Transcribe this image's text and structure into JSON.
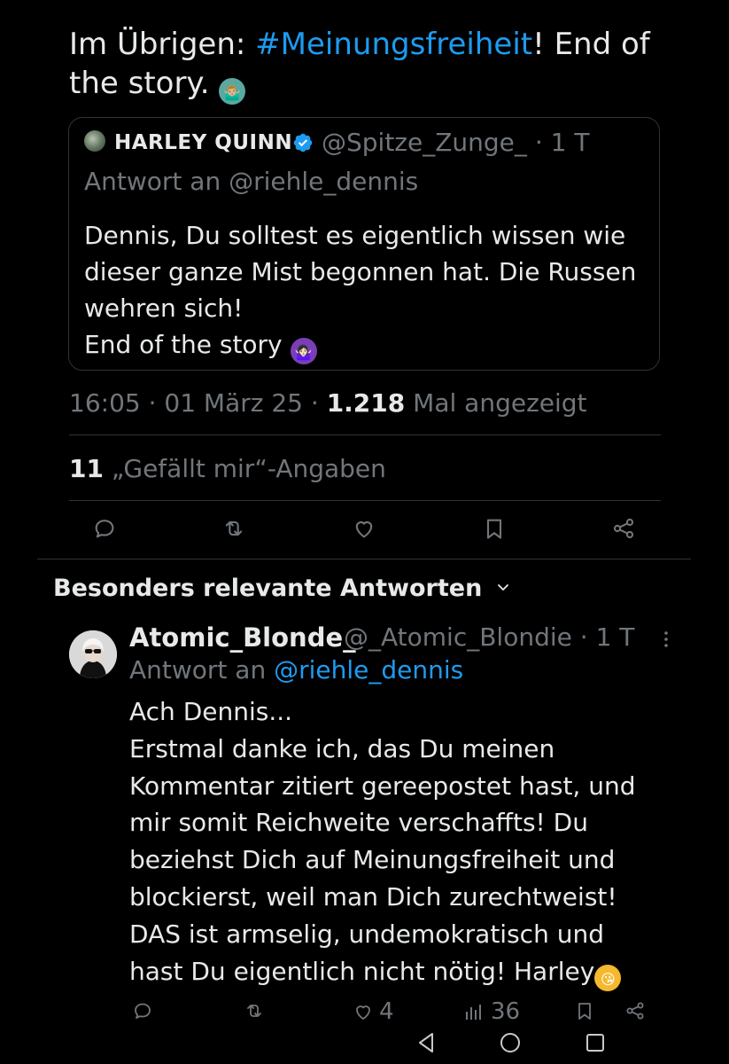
{
  "tweet": {
    "text_before": "Im Übrigen: ",
    "hashtag": "#Meinungsfreiheit",
    "text_after": "! End of the story. ",
    "emoji": "🤷🏼‍♂️"
  },
  "quote": {
    "name": "HARLEY QUINN",
    "handle": "@Spitze_Zunge_",
    "time": "· 1 T",
    "reply_to": "Antwort an @riehle_dennis",
    "body_lines": [
      "Dennis, Du solltest es eigentlich wissen wie",
      "dieser ganze Mist begonnen hat. Die Russen",
      "wehren sich!",
      "End of the story "
    ],
    "emoji": "🤷🏻‍♀️"
  },
  "meta": {
    "time": "16:05 · 01 März 25 · ",
    "views_count": "1.218",
    "views_label": " Mal angezeigt"
  },
  "likes": {
    "count": "11",
    "label": " „Gefällt mir“-Angaben"
  },
  "actions": {
    "icons": [
      "reply-icon",
      "retweet-icon",
      "like-icon",
      "bookmark-icon",
      "share-icon"
    ]
  },
  "section": {
    "title": "Besonders relevante Antworten"
  },
  "reply": {
    "name": "Atomic_Blonde_",
    "handle": "@_Atomic_Blondie · 1 T",
    "reply_prefix": "Antwort an ",
    "reply_mention": "@riehle_dennis",
    "body_lines": [
      "Ach Dennis...",
      "Erstmal danke ich, das Du meinen",
      "Kommentar zitiert gereepostet hast, und",
      "mir somit Reichweite verschaffts! Du",
      "beziehst Dich auf Meinungsfreiheit und",
      "blockierst, weil man Dich zurechtweist!",
      "DAS ist armselig, undemokratisch und",
      "hast Du eigentlich nicht nötig! Harley"
    ],
    "emoji": "😘",
    "likes_count": "4",
    "views_count": "36"
  },
  "colors": {
    "background": "#000000",
    "text": "#e7e9ea",
    "muted": "#71767b",
    "accent": "#1d9bf0",
    "divider": "#2f3336"
  },
  "nav": {
    "icons": [
      "back-icon",
      "home-icon",
      "recents-icon"
    ]
  }
}
